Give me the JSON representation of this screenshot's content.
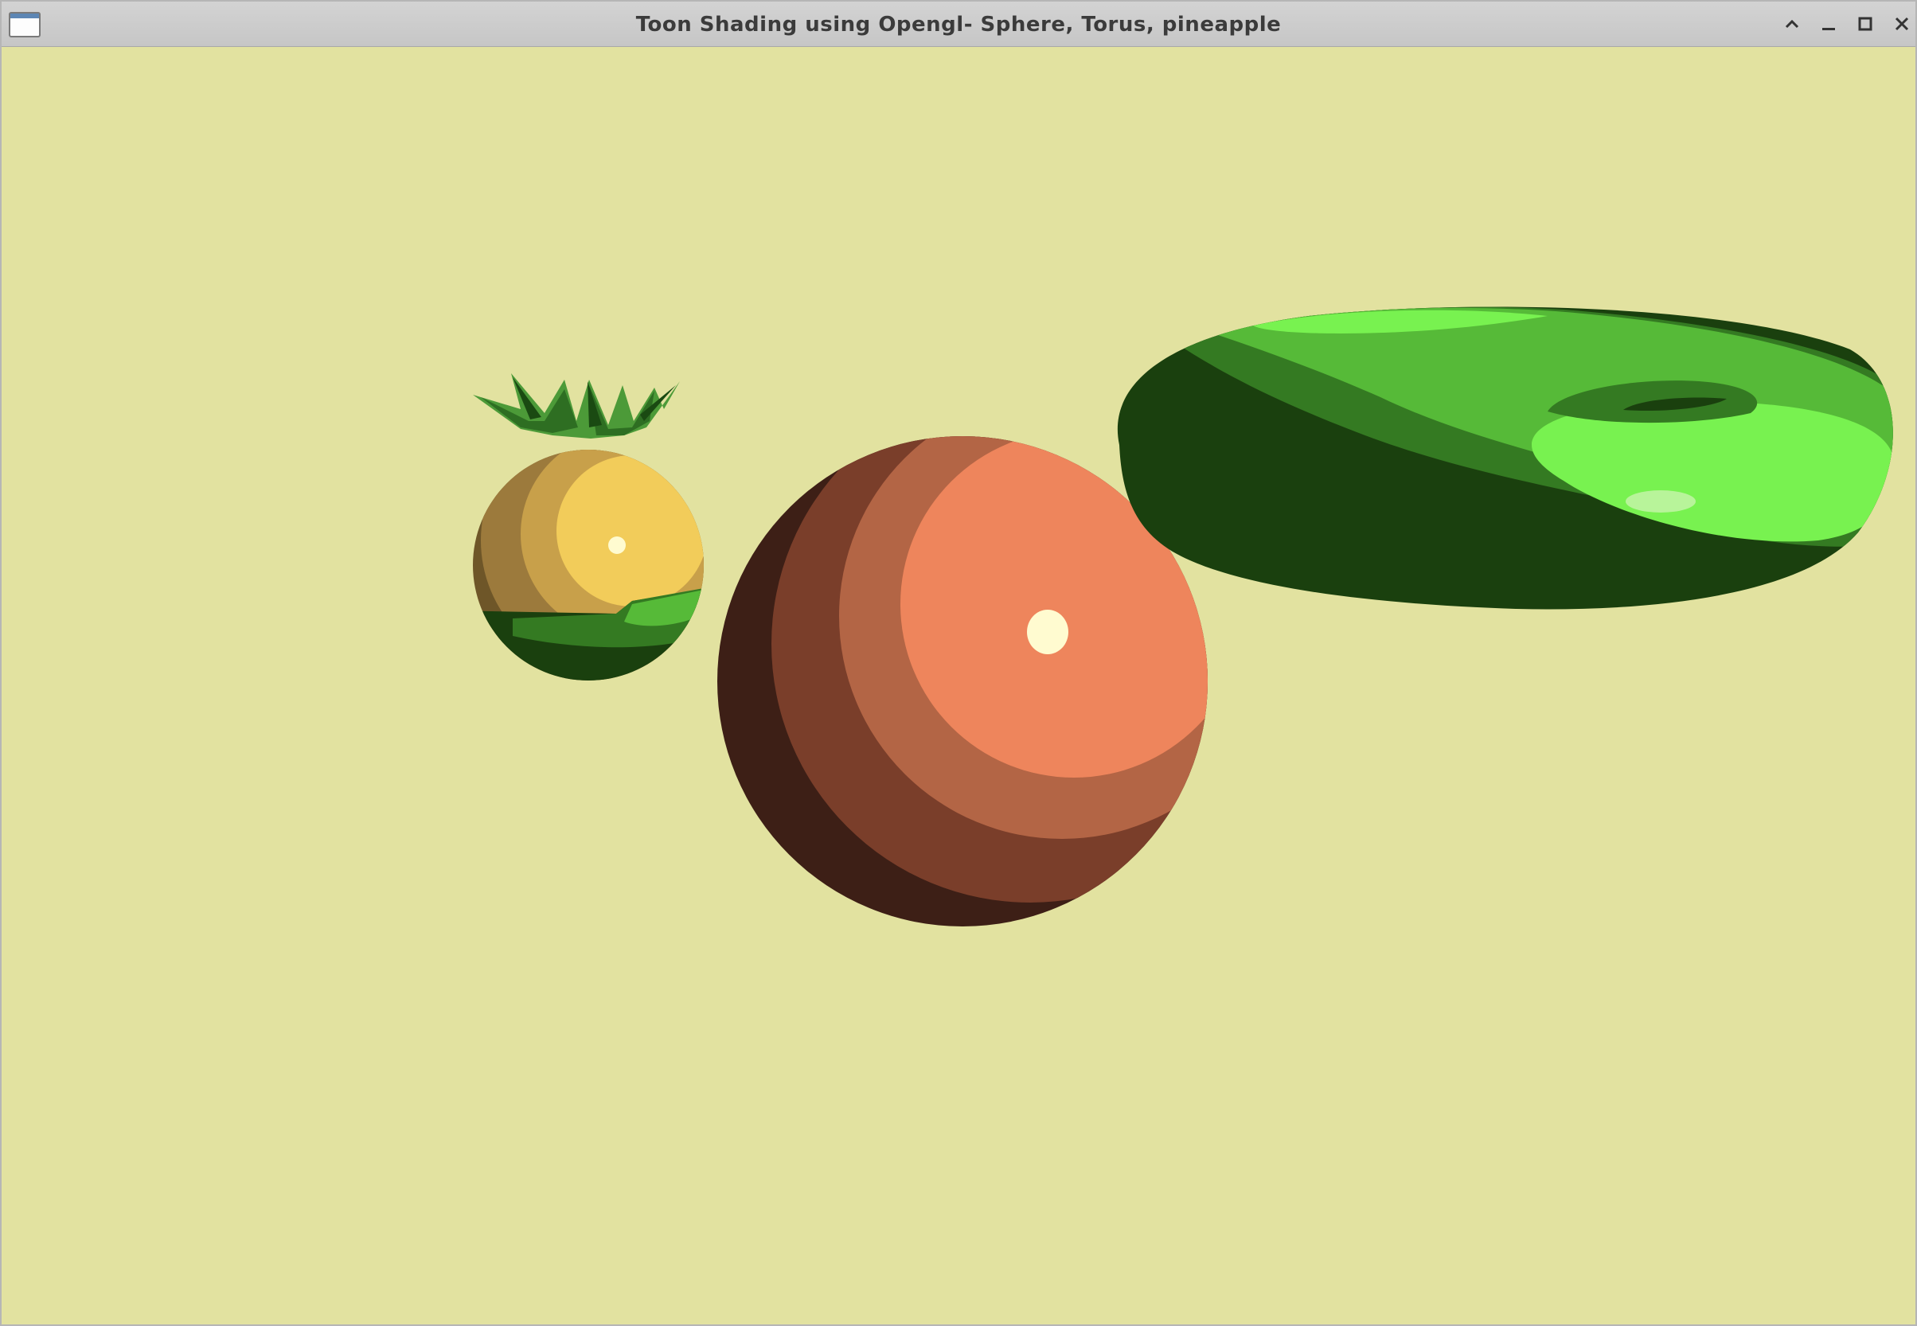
{
  "window": {
    "title": "Toon Shading using Opengl- Sphere, Torus, pineapple",
    "controls": [
      "chevron-up-icon",
      "minimize-icon",
      "maximize-icon",
      "close-icon"
    ]
  },
  "scene": {
    "background_color": "#e2e2a0",
    "objects": [
      {
        "name": "pineapple",
        "body_colors": [
          "#f2cc5a",
          "#c8a04a",
          "#9c7a3c",
          "#6e5628"
        ],
        "leaf_colors": [
          "#4c9a38",
          "#2e6e22",
          "#1a4a12"
        ]
      },
      {
        "name": "sphere",
        "colors": [
          "#ee855c",
          "#b36545",
          "#7a3e2a",
          "#3d1f16"
        ],
        "highlight": "#fffbd0"
      },
      {
        "name": "torus",
        "colors": [
          "#78f250",
          "#56ba38",
          "#347a22",
          "#1a400e"
        ],
        "highlight": "#b8f49a"
      }
    ]
  }
}
